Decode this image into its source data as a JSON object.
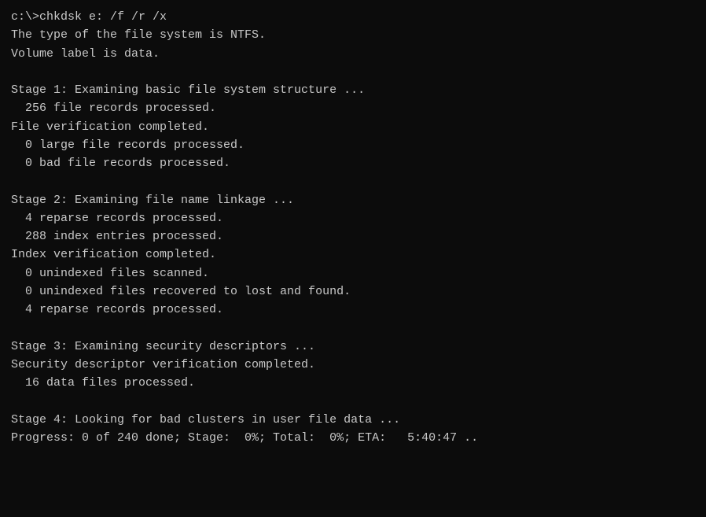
{
  "terminal": {
    "lines": [
      {
        "id": "cmd",
        "text": "c:\\>chkdsk e: /f /r /x"
      },
      {
        "id": "line1",
        "text": "The type of the file system is NTFS."
      },
      {
        "id": "line2",
        "text": "Volume label is data."
      },
      {
        "id": "spacer1",
        "text": ""
      },
      {
        "id": "line3",
        "text": "Stage 1: Examining basic file system structure ..."
      },
      {
        "id": "line4",
        "text": "  256 file records processed."
      },
      {
        "id": "line5",
        "text": "File verification completed."
      },
      {
        "id": "line6",
        "text": "  0 large file records processed."
      },
      {
        "id": "line7",
        "text": "  0 bad file records processed."
      },
      {
        "id": "spacer2",
        "text": ""
      },
      {
        "id": "line8",
        "text": "Stage 2: Examining file name linkage ..."
      },
      {
        "id": "line9",
        "text": "  4 reparse records processed."
      },
      {
        "id": "line10",
        "text": "  288 index entries processed."
      },
      {
        "id": "line11",
        "text": "Index verification completed."
      },
      {
        "id": "line12",
        "text": "  0 unindexed files scanned."
      },
      {
        "id": "line13",
        "text": "  0 unindexed files recovered to lost and found."
      },
      {
        "id": "line14",
        "text": "  4 reparse records processed."
      },
      {
        "id": "spacer3",
        "text": ""
      },
      {
        "id": "line15",
        "text": "Stage 3: Examining security descriptors ..."
      },
      {
        "id": "line16",
        "text": "Security descriptor verification completed."
      },
      {
        "id": "line17",
        "text": "  16 data files processed."
      },
      {
        "id": "spacer4",
        "text": ""
      },
      {
        "id": "line18",
        "text": "Stage 4: Looking for bad clusters in user file data ..."
      },
      {
        "id": "line19",
        "text": "Progress: 0 of 240 done; Stage:  0%; Total:  0%; ETA:   5:40:47 .."
      }
    ]
  }
}
